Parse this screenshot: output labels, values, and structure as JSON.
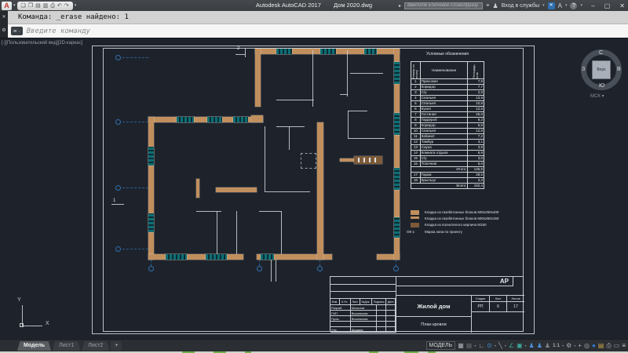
{
  "titlebar": {
    "app_title": "Autodesk AutoCAD 2017",
    "doc_title": "Дом 2020.dwg",
    "search_placeholder": "Введите ключевое слово/фразу",
    "signin_label": "Вход в службы"
  },
  "qat_icons": [
    {
      "name": "new-file-icon",
      "glyph": "❏"
    },
    {
      "name": "open-file-icon",
      "glyph": "❐"
    },
    {
      "name": "save-icon",
      "glyph": "▤"
    },
    {
      "name": "save-as-icon",
      "glyph": "▥"
    },
    {
      "name": "plot-icon",
      "glyph": "⎙"
    },
    {
      "name": "undo-icon",
      "glyph": "↶"
    },
    {
      "name": "redo-icon",
      "glyph": "↷"
    }
  ],
  "command": {
    "history": "Команда: _erase найдено: 1",
    "prompt_placeholder": "Введите команду"
  },
  "viewport_label": "[-][Пользовательский вид][2D-каркас]",
  "viewcube": {
    "north": "С",
    "south": "Ю",
    "west": "З",
    "east": "В",
    "top": "Верх",
    "wcs": "МСК"
  },
  "plan": {
    "section_top": "2",
    "section_left": "1",
    "ucs_x": "X",
    "ucs_y": "Y"
  },
  "legend_table": {
    "title": "Условные обозначения",
    "col_num": "Номер по плану",
    "col_name": "Наименование",
    "col_area": "Площадь, м.кв",
    "rows": [
      [
        "1",
        "Прихожая",
        "7,9"
      ],
      [
        "2",
        "Коридор",
        "7,7"
      ],
      [
        "3",
        "С/у",
        "2,9"
      ],
      [
        "4",
        "Спальня",
        "13,9"
      ],
      [
        "5",
        "Спальня",
        "10,8"
      ],
      [
        "6",
        "Кухня",
        "12,5"
      ],
      [
        "7",
        "Гостиная",
        "25,0"
      ],
      [
        "8",
        "Гардероб",
        "9,2"
      ],
      [
        "9",
        "Коридор",
        "6,8"
      ],
      [
        "10",
        "Спальня",
        "12,8"
      ],
      [
        "11",
        "Кабинет",
        "7,2"
      ],
      [
        "12",
        "Тамбур",
        "3,1"
      ],
      [
        "13",
        "Сауна",
        "3,9"
      ],
      [
        "14",
        "Комната отдыха",
        "6,9"
      ],
      [
        "15",
        "С/у",
        "3,0"
      ],
      [
        "16",
        "Топочная",
        "6,6"
      ],
      [
        "",
        "Итого:",
        "136,5"
      ],
      [
        "17",
        "Гараж",
        "28,5"
      ],
      [
        "18",
        "Крыльцо",
        "3,3"
      ],
      [
        "",
        "Всего:",
        "162,4"
      ]
    ]
  },
  "hatch_legend": [
    {
      "swatch": "gas-block-thick",
      "label": "Кладка из газобетонных блоков 600х250х400"
    },
    {
      "swatch": "gas-block-thin",
      "label": "Кладка из газобетонных блоков 600х250х150"
    },
    {
      "swatch": "brick-sw",
      "label": "Кладка из полнотелого кирпича М150"
    },
    {
      "mark": "ОК-1",
      "label": "Марка окна по проекту"
    }
  ],
  "stamp": {
    "code": "АР",
    "header_cols": [
      "Изм.",
      "К.Уч.",
      "Лист",
      "№Док.",
      "Подпись",
      "Дата"
    ],
    "rows": [
      [
        "Разраб.",
        "Мочалов"
      ],
      [
        "ГИП",
        "Вишнякова"
      ],
      [
        "Пров.",
        "Вишнякова"
      ],
      [
        "Утв.",
        "Шадаев"
      ]
    ],
    "project": "Жилой дом",
    "sheet_name": "План кровли",
    "stage_label": "Стадия",
    "sheet_label": "Лист",
    "sheets_label": "Листов",
    "stage": "РП",
    "sheet": "6",
    "sheets": "17"
  },
  "layout_tabs": [
    {
      "label": "Модель",
      "active": true
    },
    {
      "label": "Лист1",
      "active": false
    },
    {
      "label": "Лист2",
      "active": false
    },
    {
      "label": "+",
      "active": false
    }
  ],
  "statusbar": {
    "model_label": "МОДЕЛЬ",
    "icons": [
      {
        "name": "grid-icon",
        "glyph": "▦",
        "color": "#a8adb2"
      },
      {
        "name": "snap-icon",
        "glyph": "▦",
        "color": "#5f6468",
        "caret": true
      },
      {
        "name": "ortho-icon",
        "glyph": "∟",
        "color": "#a8adb2"
      },
      {
        "name": "polar-tracking-icon",
        "glyph": "⊙",
        "color": "#4a90d9",
        "caret": true
      },
      {
        "name": "isodraft-icon",
        "glyph": "╲",
        "color": "#a8adb2",
        "caret": true
      },
      {
        "name": "osnap-tracking-icon",
        "glyph": "∠",
        "color": "#3fae9f"
      },
      {
        "name": "osnap-icon",
        "glyph": "▣",
        "color": "#3fae9f",
        "caret": true
      },
      {
        "name": "annotation-visibility-icon",
        "glyph": "♟",
        "color": "#4a90d9"
      },
      {
        "name": "annotation-autoscale-icon",
        "glyph": "♟",
        "color": "#4a90d9"
      },
      {
        "name": "annotation-person-icon",
        "glyph": "♟",
        "color": "#7d8287"
      },
      {
        "name": "annotation-scale-button",
        "glyph": "1:1",
        "color": "#cfd3d7",
        "caret": true,
        "text": true
      },
      {
        "name": "workspace-gear-icon",
        "glyph": "⚙",
        "color": "#a8adb2",
        "caret": true
      },
      {
        "name": "annotation-monitor-icon",
        "glyph": "+",
        "color": "#a8adb2"
      },
      {
        "name": "isolate-objects-icon",
        "glyph": "◎",
        "color": "#a8adb2"
      },
      {
        "name": "graphics-performance-icon",
        "glyph": "●",
        "color": "#2f7fd6"
      },
      {
        "name": "plot-preview-icon",
        "glyph": "▤",
        "color": "#c9a648"
      },
      {
        "name": "printer-icon",
        "glyph": "⎙",
        "color": "#a8adb2"
      },
      {
        "name": "fullscreen-icon",
        "glyph": "▭",
        "color": "#a8adb2"
      },
      {
        "name": "clean-screen-icon",
        "glyph": "≡",
        "color": "#cfd3d7"
      }
    ]
  },
  "colors": {
    "wall_tan": "#c18f5d",
    "window_teal": "#0e6e74",
    "brick_brown": "#7d5a38",
    "accent_blue": "#2f6fb0",
    "canvas_bg": "#1e232b",
    "line_white": "#d2d6da",
    "paper_line": "#b9c0c7"
  }
}
